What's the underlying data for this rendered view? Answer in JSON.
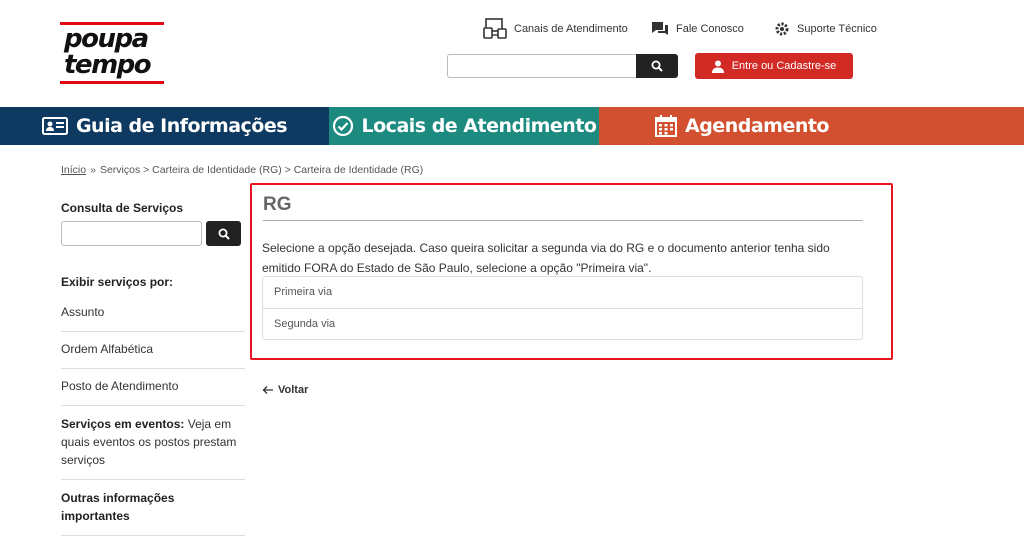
{
  "logo": {
    "line1": "poupa",
    "line2": "tempo"
  },
  "header": {
    "links": [
      "Canais de Atendimento",
      "Fale Conosco",
      "Suporte Técnico"
    ],
    "search_value": "",
    "login_label": "Entre ou Cadastre-se"
  },
  "nav": {
    "items": [
      "Guia de Informações",
      "Locais de Atendimento",
      "Agendamento"
    ]
  },
  "breadcrumb": {
    "home": "Início",
    "separator": "»",
    "rest": "Serviços > Carteira de Identidade (RG) > Carteira de Identidade (RG)"
  },
  "sidebar": {
    "search_title": "Consulta de Serviços",
    "search_value": "",
    "filter_heading": "Exibir serviços por:",
    "links": [
      "Assunto",
      "Ordem Alfabética",
      "Posto de Atendimento"
    ],
    "events_bold": "Serviços em eventos:",
    "events_text": " Veja em quais eventos os postos prestam serviços",
    "other_info": "Outras informações importantes"
  },
  "main": {
    "title": "RG",
    "intro": "Selecione a opção desejada. Caso queira solicitar a segunda via do RG e o documento anterior tenha sido emitido FORA do Estado de São Paulo, selecione a opção \"Primeira via\".",
    "options": [
      "Primeira via",
      "Segunda via"
    ],
    "back_label": "Voltar"
  },
  "colors": {
    "nav_guia": "#0e3a62",
    "nav_locais": "#1d8a80",
    "nav_agendamento": "#d2502f",
    "login_button": "#d22b26",
    "highlight_frame": "#e8141f"
  },
  "icons": [
    "monitor-icon",
    "chat-icon",
    "gear-icon",
    "search-icon",
    "user-icon",
    "id-card-icon",
    "clock-check-icon",
    "calendar-icon",
    "arrow-left-icon"
  ]
}
